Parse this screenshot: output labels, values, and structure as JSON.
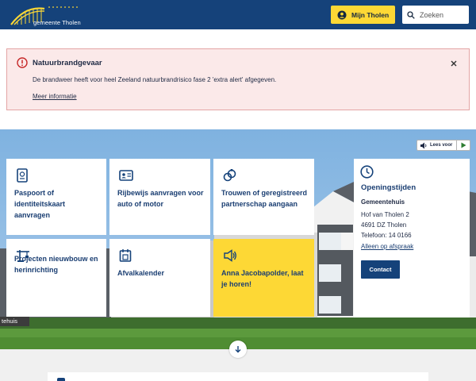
{
  "header": {
    "logo_text": "gemeente Tholen",
    "mijn_tholen_label": "Mijn Tholen",
    "search_placeholder": "Zoeken"
  },
  "alert": {
    "title": "Natuurbrandgevaar",
    "message": "De brandweer heeft voor heel Zeeland natuurbrandrisico fase 2 'extra alert' afgegeven.",
    "link": "Meer informatie"
  },
  "read_aloud": {
    "label": "Lees voor"
  },
  "tiles": [
    {
      "label": "Paspoort of identiteitskaart aanvragen",
      "icon": "passport-icon"
    },
    {
      "label": "Rijbewijs aanvragen voor auto of motor",
      "icon": "id-card-icon"
    },
    {
      "label": "Trouwen of geregistreerd partnerschap aangaan",
      "icon": "rings-icon"
    },
    {
      "label": "Projecten nieuwbouw en herinrichting",
      "icon": "crane-icon"
    },
    {
      "label": "Afvalkalender",
      "icon": "calendar-icon"
    },
    {
      "label": "Anna Jacobapolder, laat je horen!",
      "icon": "megaphone-icon"
    }
  ],
  "opening": {
    "title": "Openingstijden",
    "name": "Gemeentehuis",
    "address_line1": "Hof van Tholen 2",
    "address_line2": "4691 DZ Tholen",
    "phone": "Telefoon: 14 0166",
    "appointment_link": "Alleen op afspraak",
    "contact_button": "Contact"
  },
  "hero_caption": "tehuis",
  "colors": {
    "header_bg": "#15427a",
    "accent_yellow": "#fdd835",
    "alert_bg": "#fbe9e9",
    "alert_border": "#e4a5a5",
    "alert_icon": "#c62828"
  }
}
